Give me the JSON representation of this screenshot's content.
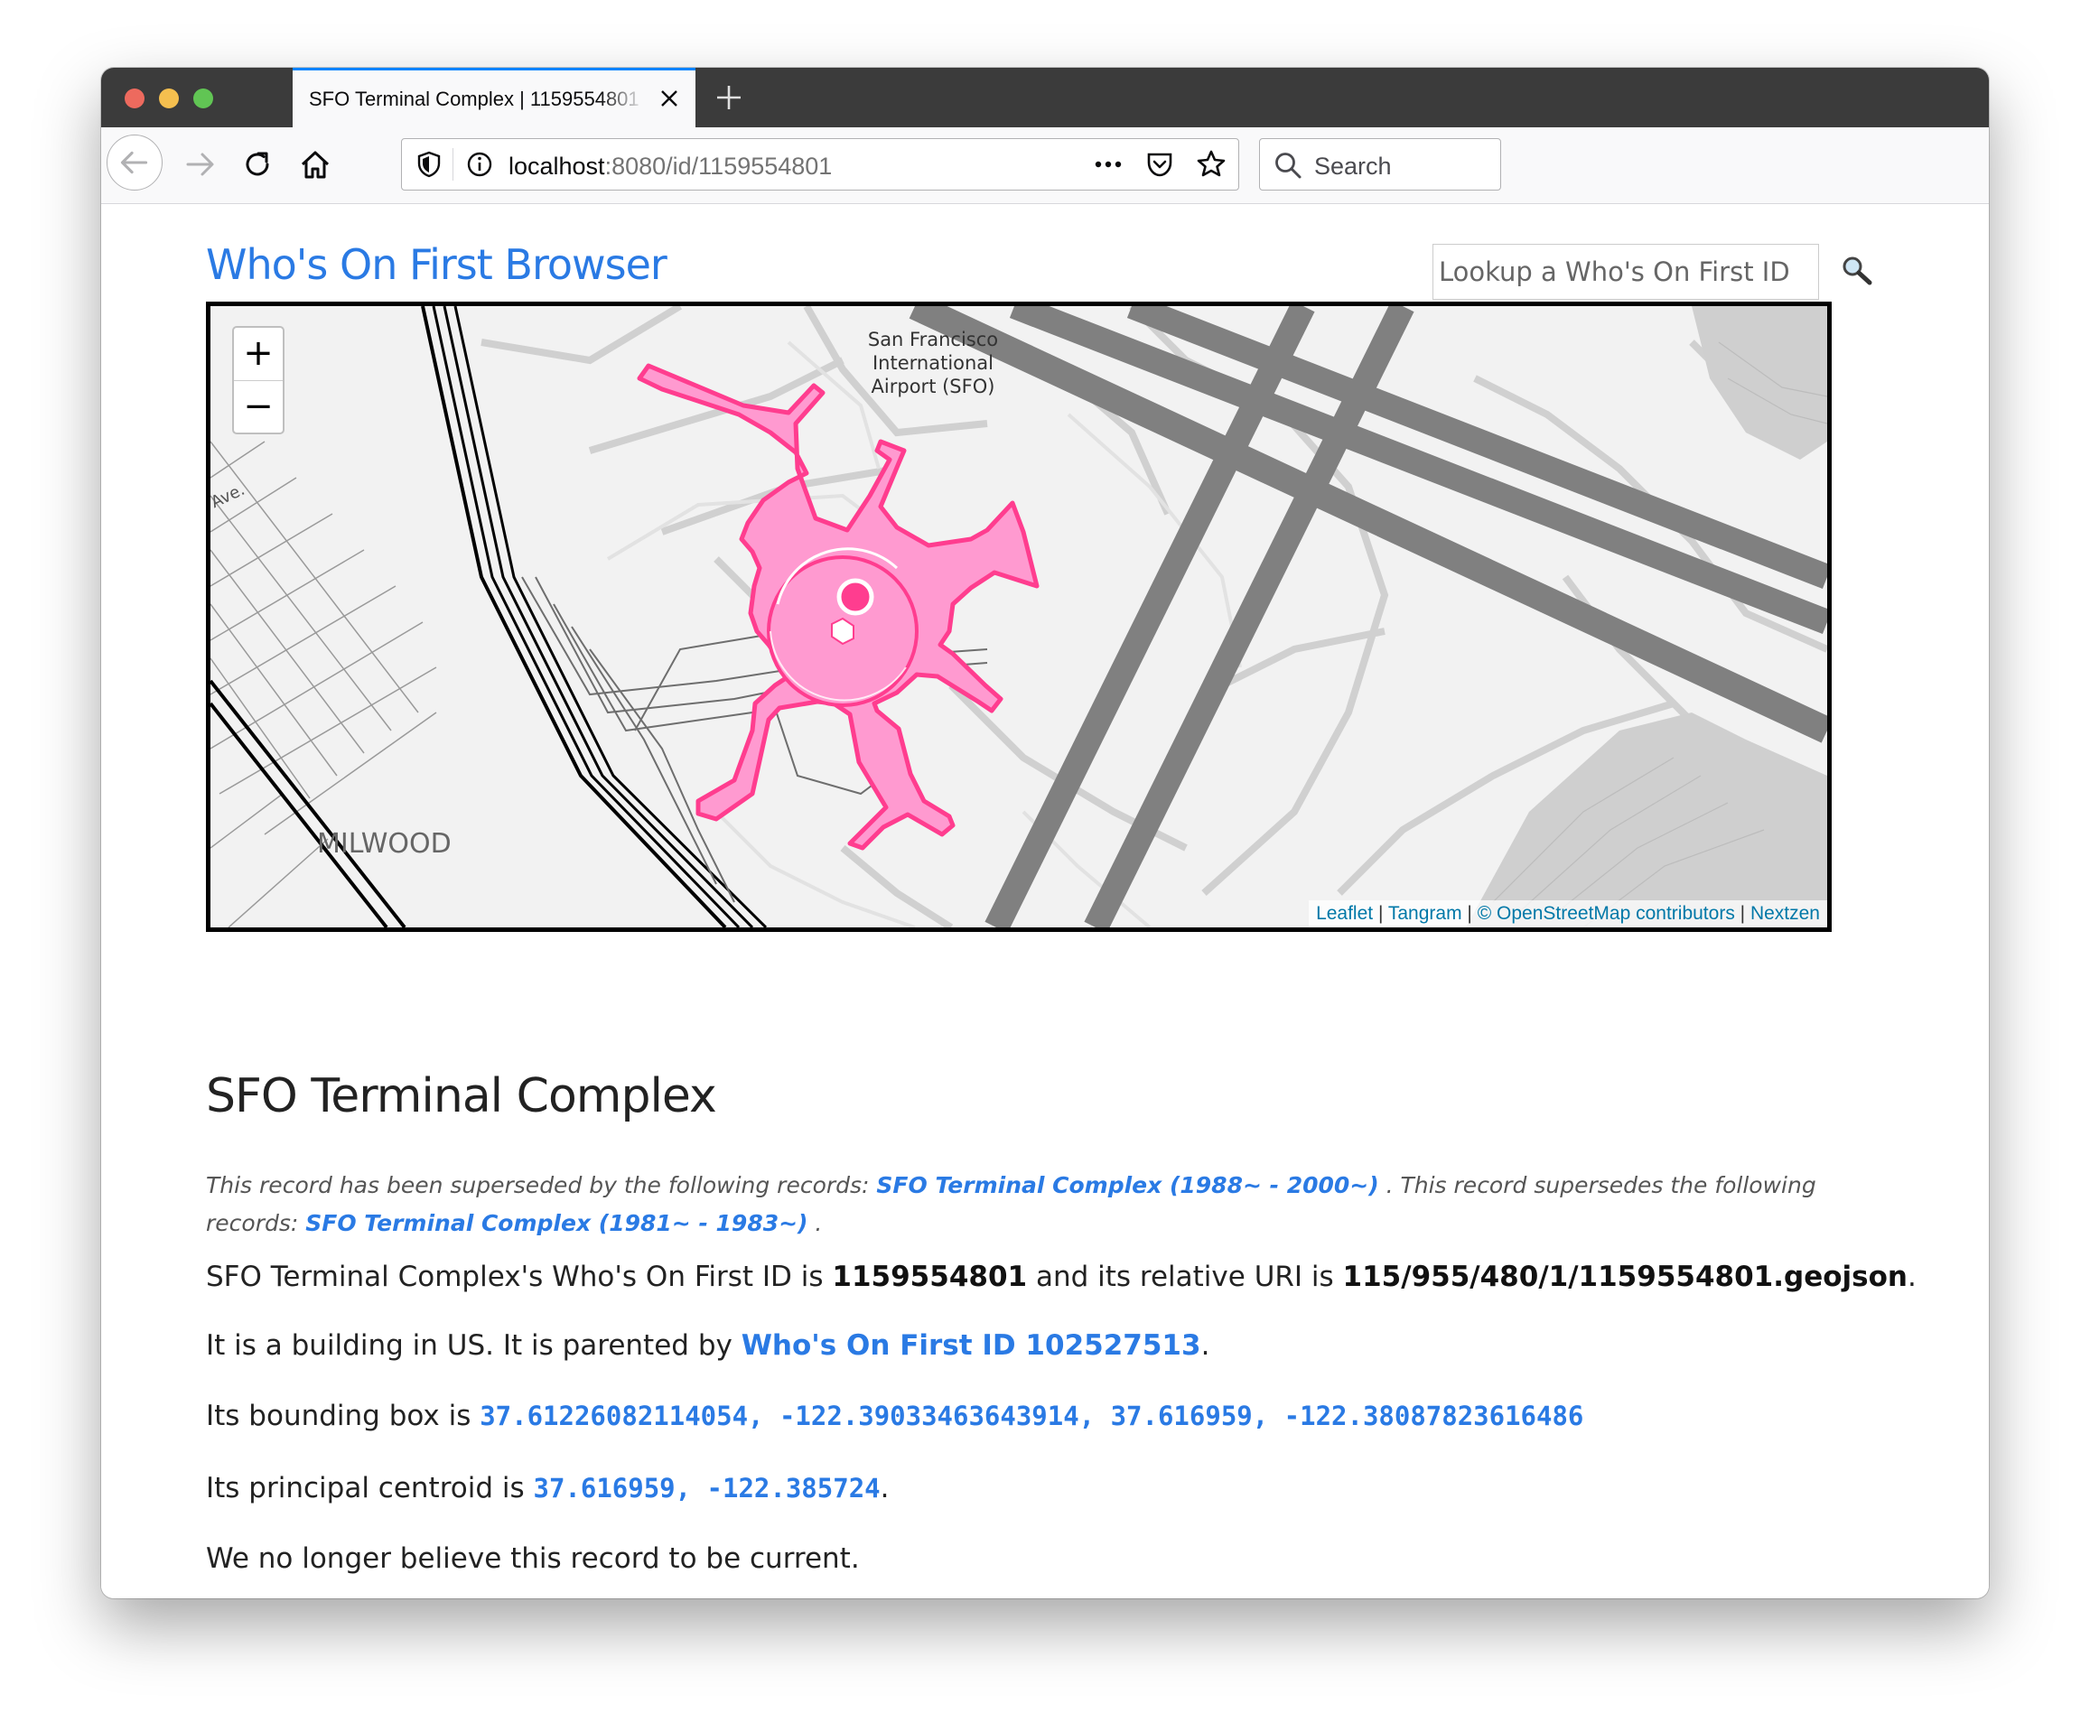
{
  "browser": {
    "tab_title": "SFO Terminal Complex | 1159554801",
    "url_host": "localhost",
    "url_path": ":8080/id/1159554801",
    "search_placeholder": "Search"
  },
  "page": {
    "site_title": "Who's On First Browser",
    "lookup_placeholder": "Lookup a Who's On First ID",
    "map": {
      "zoom_in": "+",
      "zoom_out": "−",
      "labels": {
        "airport_line1": "San Francisco",
        "airport_line2": "International",
        "airport_line3": "Airport (SFO)",
        "neighborhood": "MILWOOD",
        "street": "Ave."
      },
      "attribution": {
        "leaflet": "Leaflet",
        "sep1": " | ",
        "tangram": "Tangram",
        "sep2": " | ",
        "osm": "© OpenStreetMap contributors",
        "sep3": " | ",
        "nextzen": "Nextzen"
      },
      "colors": {
        "feature_fill": "#ff9ad0",
        "feature_stroke": "#ff3d8f",
        "runway": "#808080"
      }
    },
    "record_title": "SFO Terminal Complex",
    "notice": {
      "prefix": "This record has been superseded by the following records: ",
      "superseded_by": "SFO Terminal Complex (1988~ - 2000~)",
      "middle": " . This record supersedes the following records: ",
      "supersedes": "SFO Terminal Complex (1981~ - 1983~)",
      "suffix": " ."
    },
    "id_sentence": {
      "prefix": "SFO Terminal Complex's Who's On First ID is ",
      "id": "1159554801",
      "middle": " and its relative URI is ",
      "uri": "115/955/480/1/1159554801.geojson",
      "suffix": "."
    },
    "parent_sentence": {
      "prefix": "It is a building in US. It is parented by ",
      "link": "Who's On First ID 102527513",
      "suffix": "."
    },
    "bbox_sentence": {
      "prefix": "Its bounding box is ",
      "value": "37.61226082114054, -122.39033463643914, 37.616959, -122.38087823616486"
    },
    "centroid_sentence": {
      "prefix": "Its principal centroid is ",
      "value": "37.616959, -122.385724",
      "suffix": "."
    },
    "current_sentence": "We no longer believe this record to be current."
  }
}
